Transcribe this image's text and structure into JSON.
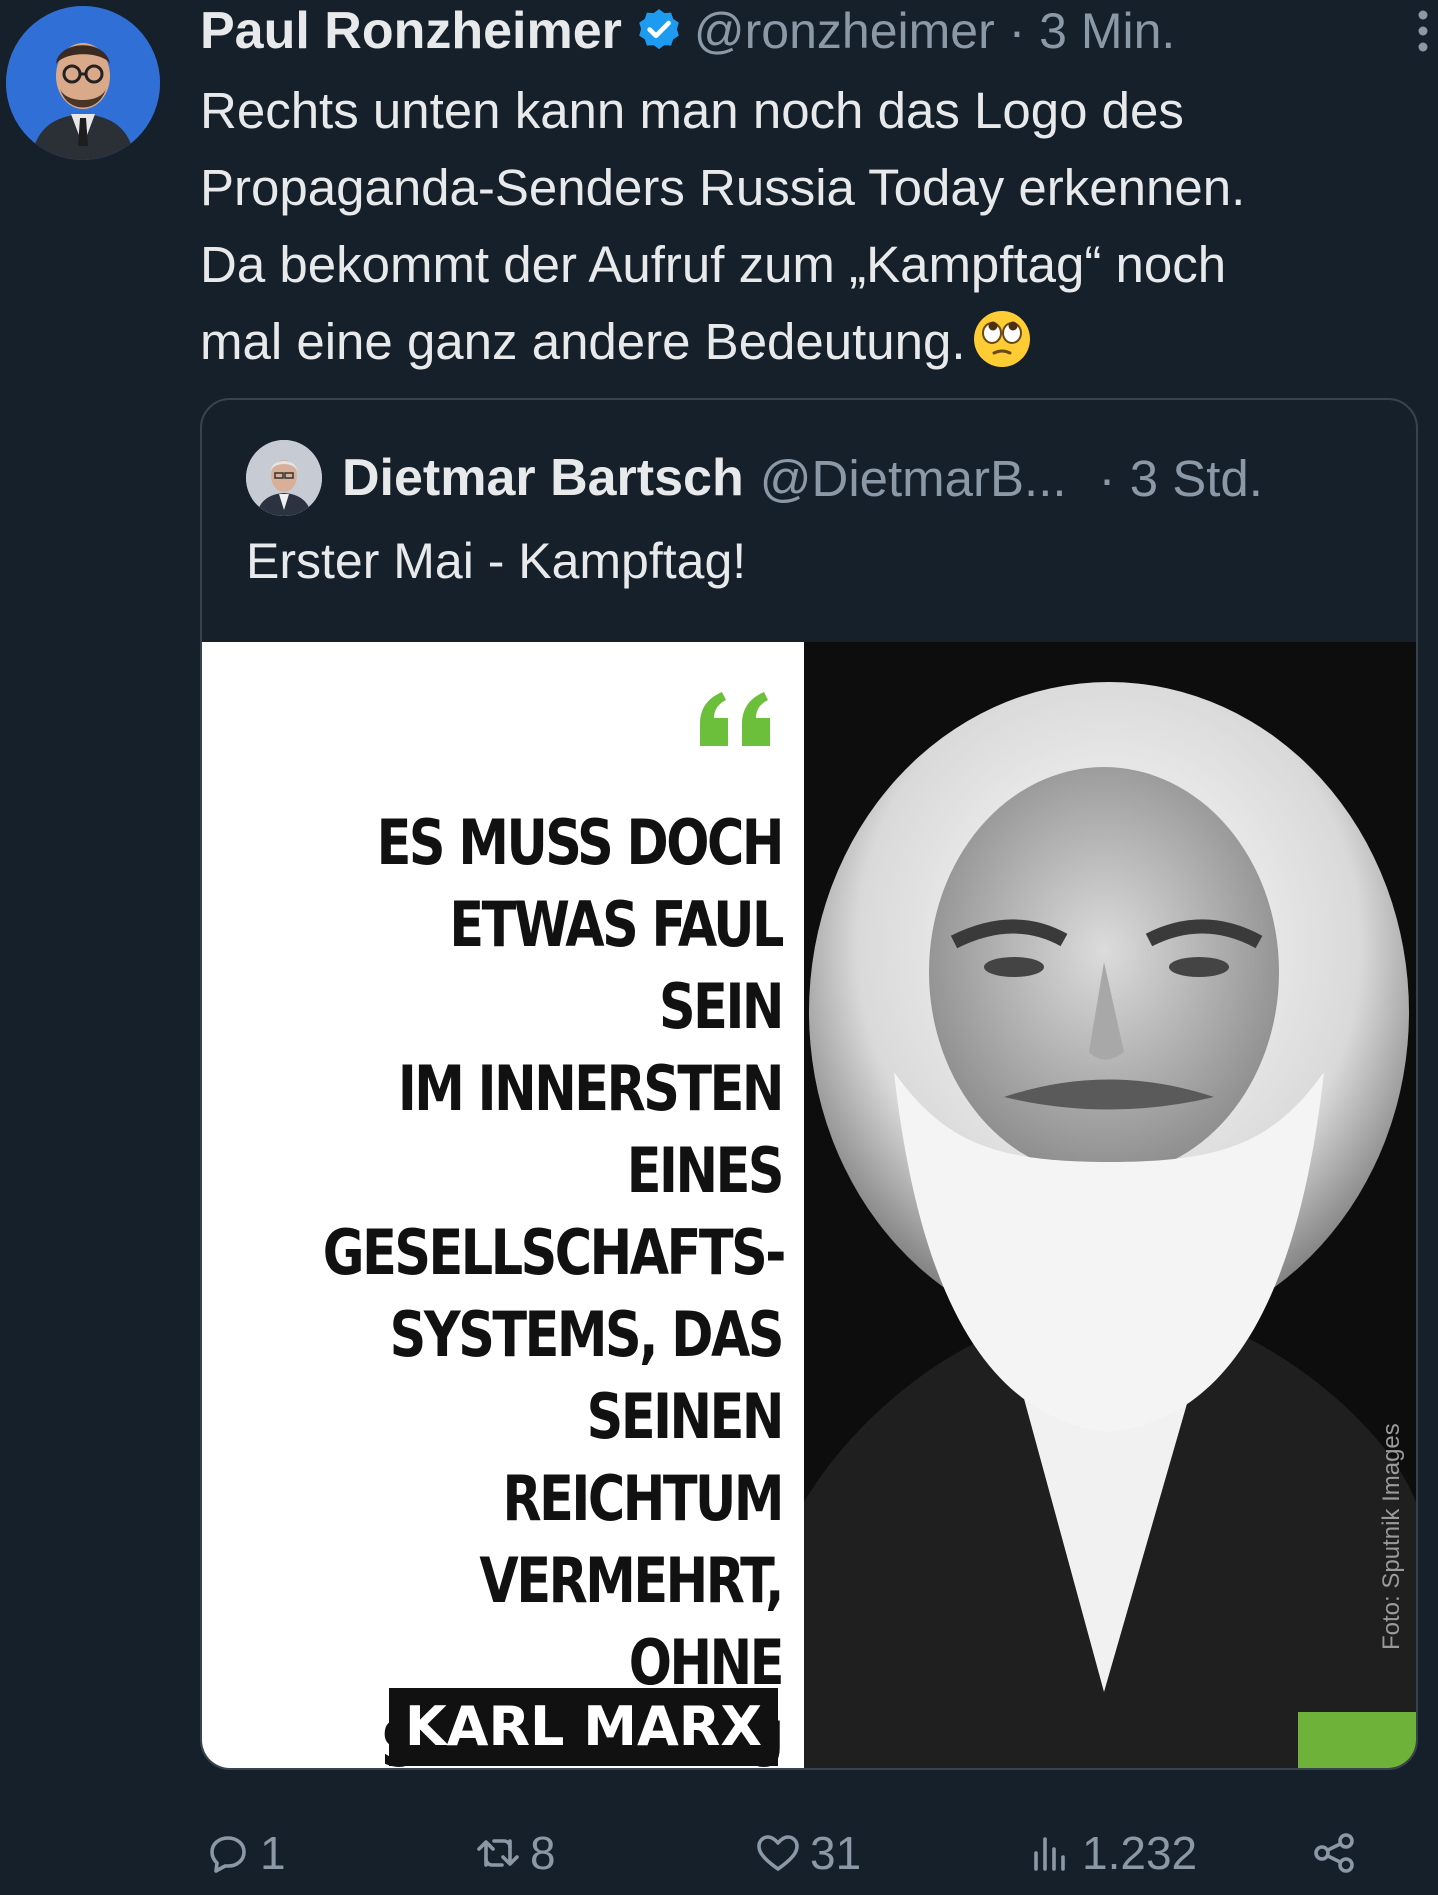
{
  "tweet": {
    "author_name": "Paul Ronzheimer",
    "handle_time": "@ronzheimer · 3 Min.",
    "text": "Rechts unten kann man noch das Logo des\nPropaganda-Senders Russia Today erkennen.\nDa bekommt der Aufruf zum „Kampftag“ noch\nmal eine ganz andere Bedeutung.",
    "emoji": "face-with-rolling-eyes"
  },
  "quoted": {
    "author_name": "Dietmar Bartsch",
    "handle": "@DietmarB...",
    "time": "· 3 Std.",
    "text": "Erster Mai - Kampftag!",
    "image": {
      "quote_mark": "“",
      "quote": "ES MUSS DOCH\nETWAS FAUL SEIN\nIM INNERSTEN\nEINES\nGESELLSCHAFTS-\nSYSTEMS, DAS\nSEINEN REICHTUM\nVERMEHRT, OHNE\nSEIN ELEND ZU\nVERRINGERN.",
      "signature": "KARL MARX",
      "photo_credit": "Foto: Sputnik Images"
    }
  },
  "actions": {
    "replies": "1",
    "retweets": "8",
    "likes": "31",
    "views": "1.232"
  },
  "colors": {
    "background": "#15202b",
    "text": "#e7e9ea",
    "muted": "#8b98a5",
    "verified": "#1d9bf0",
    "accent_green": "#6fb23a"
  }
}
